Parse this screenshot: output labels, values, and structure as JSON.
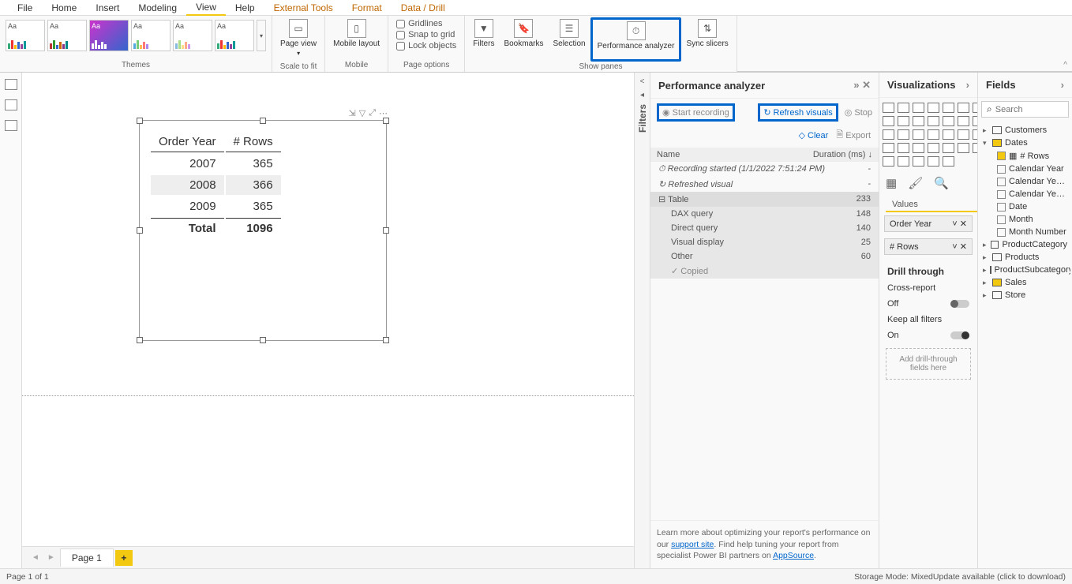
{
  "menu": [
    "File",
    "Home",
    "Insert",
    "Modeling",
    "View",
    "Help",
    "External Tools",
    "Format",
    "Data / Drill"
  ],
  "menu_active": "View",
  "menu_colored": [
    "External Tools",
    "Format",
    "Data / Drill"
  ],
  "ribbon": {
    "themes_label": "Themes",
    "scale_label": "Scale to fit",
    "mobile_label": "Mobile",
    "page_options_label": "Page options",
    "show_panes_label": "Show panes",
    "page_view": "Page view",
    "mobile_layout": "Mobile layout",
    "gridlines": "Gridlines",
    "snap": "Snap to grid",
    "lock": "Lock objects",
    "filters": "Filters",
    "bookmarks": "Bookmarks",
    "selection": "Selection",
    "perf": "Performance analyzer",
    "sync": "Sync slicers"
  },
  "table": {
    "headers": [
      "Order Year",
      "# Rows"
    ],
    "rows": [
      [
        "2007",
        "365"
      ],
      [
        "2008",
        "366"
      ],
      [
        "2009",
        "365"
      ]
    ],
    "total_label": "Total",
    "total_value": "1096"
  },
  "pages": {
    "tab": "Page 1"
  },
  "filters_label": "Filters",
  "perf": {
    "title": "Performance analyzer",
    "start": "Start recording",
    "refresh": "Refresh visuals",
    "stop": "Stop",
    "clear": "Clear",
    "export": "Export",
    "col_name": "Name",
    "col_dur": "Duration (ms)",
    "events": {
      "rec_started": "Recording started (1/1/2022 7:51:24 PM)",
      "refreshed": "Refreshed visual",
      "table": "Table",
      "table_ms": "233",
      "dax": "DAX query",
      "dax_ms": "148",
      "dq": "Direct query",
      "dq_ms": "140",
      "vd": "Visual display",
      "vd_ms": "25",
      "other": "Other",
      "other_ms": "60",
      "copied": "Copied"
    },
    "footer1": "Learn more about optimizing your report's performance on our ",
    "footer_link1": "support site",
    "footer2": ". Find help tuning your report from specialist Power BI partners on ",
    "footer_link2": "AppSource",
    "footer3": "."
  },
  "viz": {
    "title": "Visualizations",
    "values": "Values",
    "well1": "Order Year",
    "well2": "# Rows",
    "drill": "Drill through",
    "cross": "Cross-report",
    "off": "Off",
    "keep": "Keep all filters",
    "on": "On",
    "drop": "Add drill-through fields here"
  },
  "fields": {
    "title": "Fields",
    "search_ph": "Search",
    "tables": [
      "Customers",
      "Dates",
      "ProductCategory",
      "Products",
      "ProductSubcategory",
      "Sales",
      "Store"
    ],
    "dates_children": [
      {
        "name": "# Rows",
        "checked": true
      },
      {
        "name": "Calendar Year",
        "checked": false
      },
      {
        "name": "Calendar Year M...",
        "checked": false
      },
      {
        "name": "Calendar Year N...",
        "checked": false
      },
      {
        "name": "Date",
        "checked": false
      },
      {
        "name": "Month",
        "checked": false
      },
      {
        "name": "Month Number",
        "checked": false
      }
    ]
  },
  "status": {
    "left": "Page 1 of 1",
    "right": "Storage Mode: MixedUpdate available (click to download)"
  }
}
